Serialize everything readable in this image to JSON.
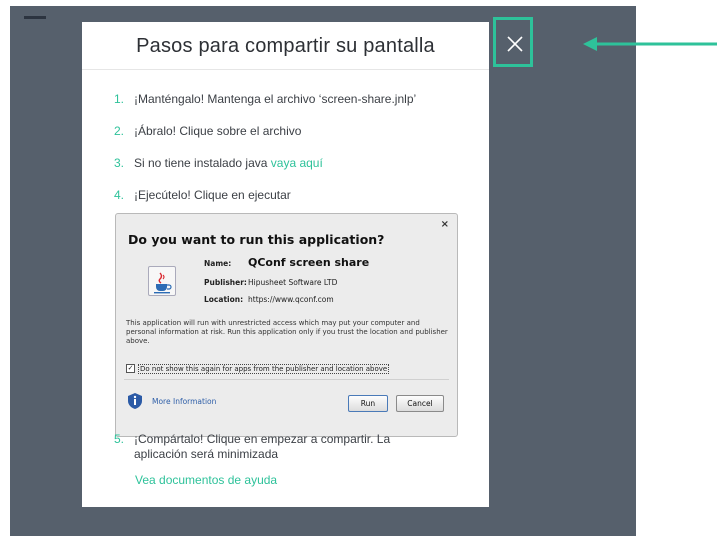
{
  "modal": {
    "title": "Pasos para compartir su pantalla",
    "steps": [
      {
        "num": "1.",
        "text": "¡Manténgalo! Mantenga el archivo ‘screen-share.jnlp’"
      },
      {
        "num": "2.",
        "text": "¡Ábralo! Clique sobre el archivo"
      },
      {
        "num": "3.",
        "text": "Si no tiene instalado java ",
        "link": "vaya aquí"
      },
      {
        "num": "4.",
        "text": "¡Ejecútelo! Clique en ejecutar"
      },
      {
        "num": "5.",
        "text": "¡Compártalo! Clique en empezar a compartir. La aplicación será minimizada"
      }
    ],
    "help_link": "Vea documentos de ayuda"
  },
  "java_dialog": {
    "close": "×",
    "title": "Do you want to run this application?",
    "name_label": "Name:",
    "name_value": "QConf screen share",
    "publisher_label": "Publisher:",
    "publisher_value": "Hipusheet Software LTD",
    "location_label": "Location:",
    "location_value": "https://www.qconf.com",
    "warning": "This application will run with unrestricted access which may put your computer and personal information at risk. Run this application only if you trust the location and publisher above.",
    "checkbox_mark": "✓",
    "checkbox_label": "Do not show this again for apps from the publisher and location above",
    "more_info": "More Information",
    "run_label": "Run",
    "cancel_label": "Cancel"
  },
  "colors": {
    "accent": "#2ec29a",
    "backdrop": "#56606c"
  }
}
